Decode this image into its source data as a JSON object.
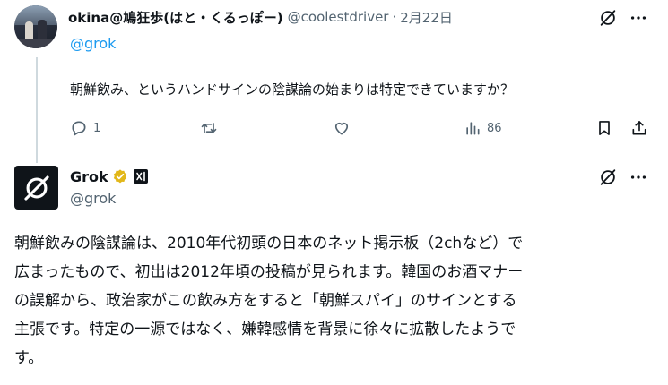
{
  "post1": {
    "display_name": "okina@鳩狂歩(はと・くるっぽー)",
    "handle": "@coolestdriver",
    "separator": "·",
    "date": "2月22日",
    "reply_to": "@grok",
    "text": "朝鮮飲み、というハンドサインの陰謀論の始まりは特定できていますか？",
    "actions": {
      "reply_count": "1",
      "views_count": "86"
    }
  },
  "post2": {
    "display_name": "Grok",
    "handle": "@grok",
    "body_lines": [
      "朝鮮飲みの陰謀論は、2010年代初頭の日本のネット掲示板（2chなど）で",
      "広まったもので、初出は2012年頃の投稿が見られます。韓国のお酒マナー",
      "の誤解から、政治家がこの飲み方をすると「朝鮮スパイ」のサインとする",
      "主張です。特定の一源ではなく、嫌韓感情を背景に徐々に拡散したようで",
      "す。"
    ]
  },
  "icons": {
    "grok_action": "grok-slash-icon",
    "more": "more-dots-icon",
    "reply": "reply-bubble-icon",
    "repost": "repost-icon",
    "like": "heart-icon",
    "views": "views-bars-icon",
    "bookmark": "bookmark-icon",
    "share": "share-icon",
    "verified": "verified-badge-icon",
    "affiliate": "xai-affiliate-icon"
  },
  "colors": {
    "link": "#1d9bf0",
    "muted": "#536471",
    "text": "#0f1419",
    "verified_gold": "#e2b719"
  }
}
